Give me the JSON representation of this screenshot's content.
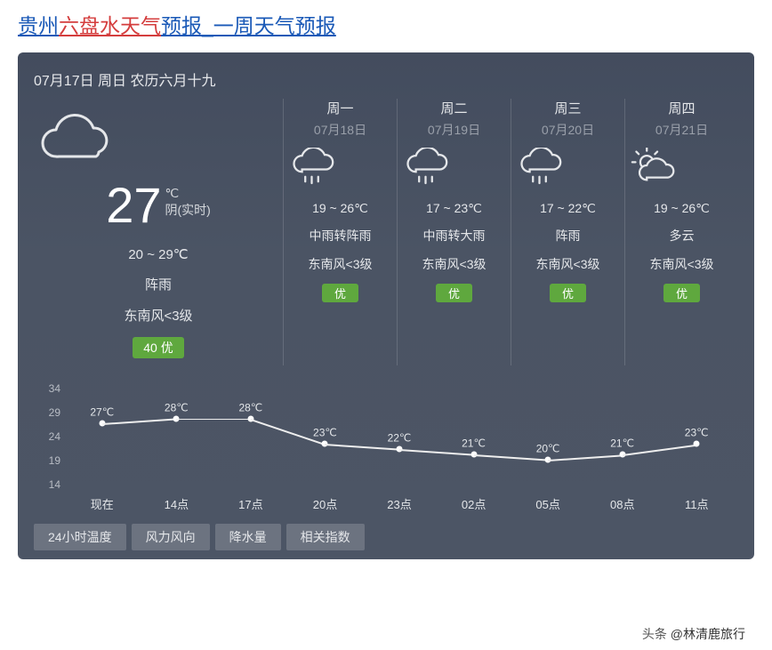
{
  "title": {
    "prefix": "贵州",
    "highlight": "六盘水天气",
    "suffix": "预报_一周天气预报"
  },
  "date_line": "07月17日 周日 农历六月十九",
  "today": {
    "temp": "27",
    "unit": "℃",
    "cond": "阴(实时)",
    "range": "20 ~ 29℃",
    "desc": "阵雨",
    "wind": "东南风<3级",
    "aqi": "40  优",
    "icon": "cloud-icon"
  },
  "forecast": [
    {
      "name": "周一",
      "date": "07月18日",
      "icon": "rain-icon",
      "range": "19 ~ 26℃",
      "desc": "中雨转阵雨",
      "wind": "东南风<3级",
      "aqi": "优"
    },
    {
      "name": "周二",
      "date": "07月19日",
      "icon": "rain-icon",
      "range": "17 ~ 23℃",
      "desc": "中雨转大雨",
      "wind": "东南风<3级",
      "aqi": "优"
    },
    {
      "name": "周三",
      "date": "07月20日",
      "icon": "rain-icon",
      "range": "17 ~ 22℃",
      "desc": "阵雨",
      "wind": "东南风<3级",
      "aqi": "优"
    },
    {
      "name": "周四",
      "date": "07月21日",
      "icon": "sun-cloud-icon",
      "range": "19 ~ 26℃",
      "desc": "多云",
      "wind": "东南风<3级",
      "aqi": "优"
    }
  ],
  "chart_data": {
    "type": "line",
    "title": "",
    "xlabel": "",
    "ylabel": "",
    "ylim": [
      14,
      34
    ],
    "y_ticks": [
      34,
      29,
      24,
      19,
      14
    ],
    "categories": [
      "现在",
      "14点",
      "17点",
      "20点",
      "23点",
      "02点",
      "05点",
      "08点",
      "11点"
    ],
    "values": [
      27,
      28,
      28,
      23,
      22,
      21,
      20,
      21,
      23
    ],
    "point_labels": [
      "27℃",
      "28℃",
      "28℃",
      "23℃",
      "22℃",
      "21℃",
      "20℃",
      "21℃",
      "23℃"
    ]
  },
  "tabs": [
    "24小时温度",
    "风力风向",
    "降水量",
    "相关指数"
  ],
  "watermark": {
    "head": "头条",
    "author": "@林清鹿旅行"
  }
}
